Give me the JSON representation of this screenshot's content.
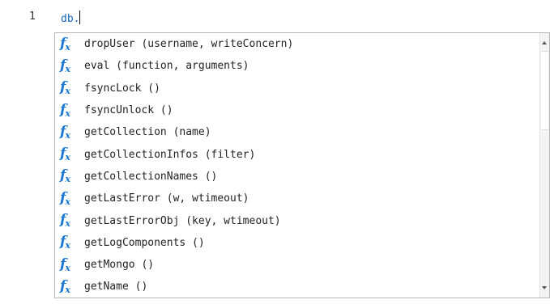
{
  "editor": {
    "line_number": "1",
    "code_text": "db."
  },
  "autocomplete": {
    "icon_name": "function-icon",
    "items": [
      {
        "label": "dropUser (username, writeConcern)"
      },
      {
        "label": "eval (function, arguments)"
      },
      {
        "label": "fsyncLock ()"
      },
      {
        "label": "fsyncUnlock ()"
      },
      {
        "label": "getCollection (name)"
      },
      {
        "label": "getCollectionInfos (filter)"
      },
      {
        "label": "getCollectionNames ()"
      },
      {
        "label": "getLastError (w, wtimeout)"
      },
      {
        "label": "getLastErrorObj (key, wtimeout)"
      },
      {
        "label": "getLogComponents ()"
      },
      {
        "label": "getMongo ()"
      },
      {
        "label": "getName ()"
      }
    ]
  },
  "colors": {
    "code_text": "#1565c0",
    "function_icon": "#1976d2",
    "popup_border": "#b5b5b5"
  }
}
